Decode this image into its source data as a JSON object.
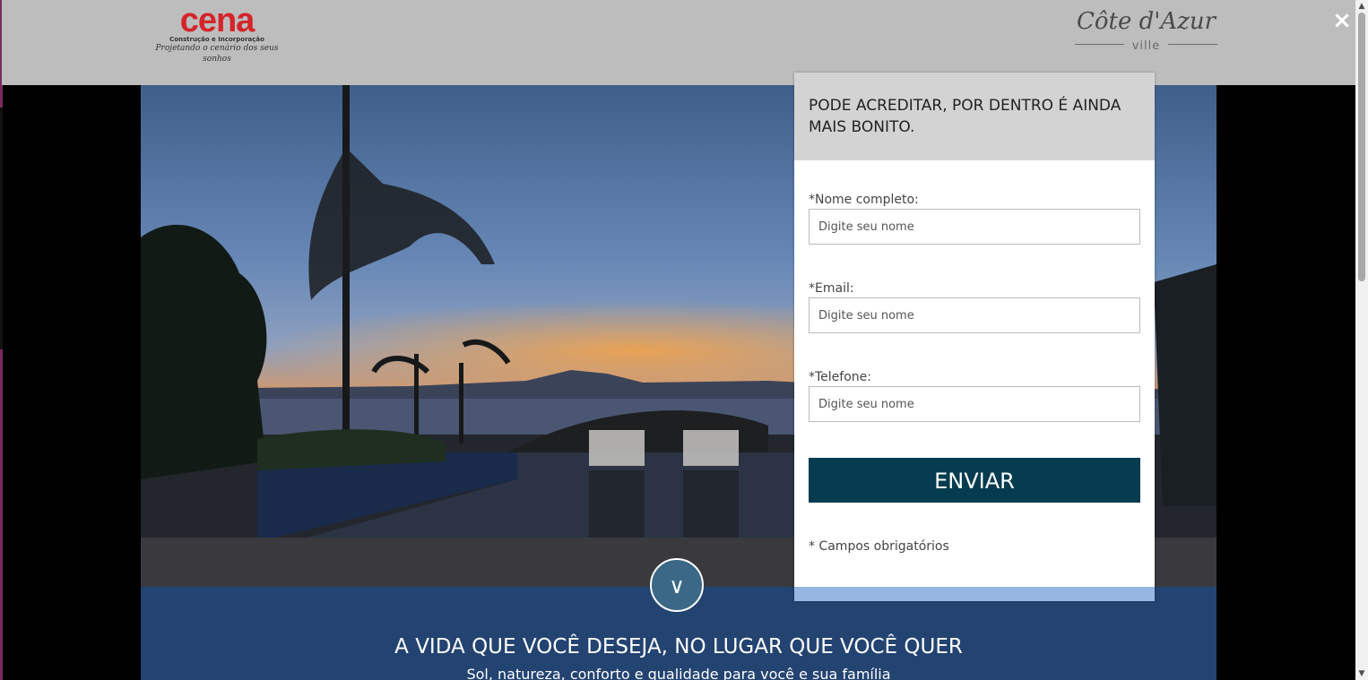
{
  "header": {
    "cena_logo": {
      "word": "cena",
      "subtitle": "Construção e Incorporação",
      "tagline": "Projetando o cenário dos seus sonhos"
    },
    "cote_logo": {
      "script": "Côte d'Azur",
      "ville": "ville"
    },
    "close_icon": "×"
  },
  "hero": {
    "scroll_down_icon": "∨",
    "tagline": "A VIDA QUE VOCÊ DESEJA, NO LUGAR QUE VOCÊ QUER",
    "subline": "Sol, natureza, conforto e qualidade para você e sua família"
  },
  "form": {
    "heading": "PODE ACREDITAR, POR DENTRO É AINDA MAIS BONITO.",
    "name_label": "*Nome completo:",
    "name_placeholder": "Digite seu nome",
    "email_label": "*Email:",
    "email_placeholder": "Digite seu nome",
    "phone_label": "*Telefone:",
    "phone_placeholder": "Digite seu nome",
    "submit_label": "ENVIAR",
    "required_note": "* Campos obrigatórios"
  },
  "colors": {
    "header_bg": "#bdbdbd",
    "brand_red": "#d5242a",
    "button_bg": "#053c4f",
    "band_blue": "#234371"
  },
  "scrollbar": {
    "up_icon": "▲",
    "down_icon": "▼"
  }
}
